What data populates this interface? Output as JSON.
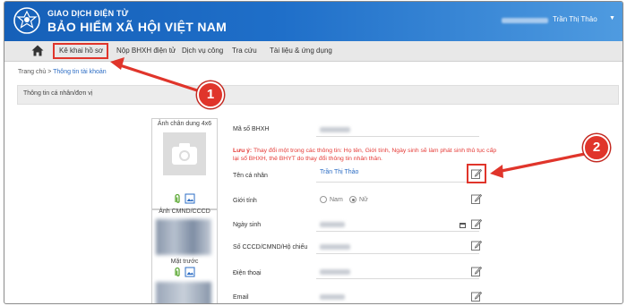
{
  "header": {
    "brand_top": "GIAO DỊCH ĐIỆN TỬ",
    "brand_main": "BẢO HIỂM XÃ HỘI VIỆT NAM",
    "user_name": "Trần Thị Thảo",
    "user_caret": "▼"
  },
  "nav": {
    "home_icon": "home-icon",
    "items": [
      {
        "label": "Kê khai hồ sơ",
        "active": true
      },
      {
        "label": "Nộp BHXH điện tử"
      },
      {
        "label": "Dịch vụ công"
      },
      {
        "label": "Tra cứu"
      },
      {
        "label": "Tài liệu & ứng dụng"
      }
    ]
  },
  "breadcrumb": {
    "home": "Trang chủ",
    "sep": ">",
    "current": "Thông tin tài khoản"
  },
  "section": {
    "title": "Thông tin cá nhân/đơn vị"
  },
  "photo": {
    "portrait_caption": "Ảnh chân dung 4x6",
    "id_caption": "Ảnh CMND/CCCD",
    "front_caption": "Mặt trước"
  },
  "form": {
    "bhxh_label": "Mã số BHXH",
    "warning_prefix": "Lưu ý:",
    "warning_text": "Thay đổi một trong các thông tin: Họ tên, Giới tính, Ngày sinh sẽ làm phát sinh thủ tục cấp lại sổ BHXH, thẻ BHYT do thay đổi thông tin nhân thân.",
    "name_label": "Tên cá nhân",
    "name_value": "Trần Thị Thảo",
    "gender_label": "Giới tính",
    "gender_options": [
      "Nam",
      "Nữ"
    ],
    "gender_selected": "Nữ",
    "dob_label": "Ngày sinh",
    "id_label": "Số CCCD/CMND/Hộ chiếu",
    "phone_label": "Điện thoại",
    "email_label": "Email"
  },
  "annotations": {
    "step1": "1",
    "step2": "2"
  },
  "colors": {
    "header_blue": "#1660b8",
    "annotation_red": "#e0352b",
    "warning_red": "#e53935",
    "link_blue": "#2b6cc4"
  }
}
